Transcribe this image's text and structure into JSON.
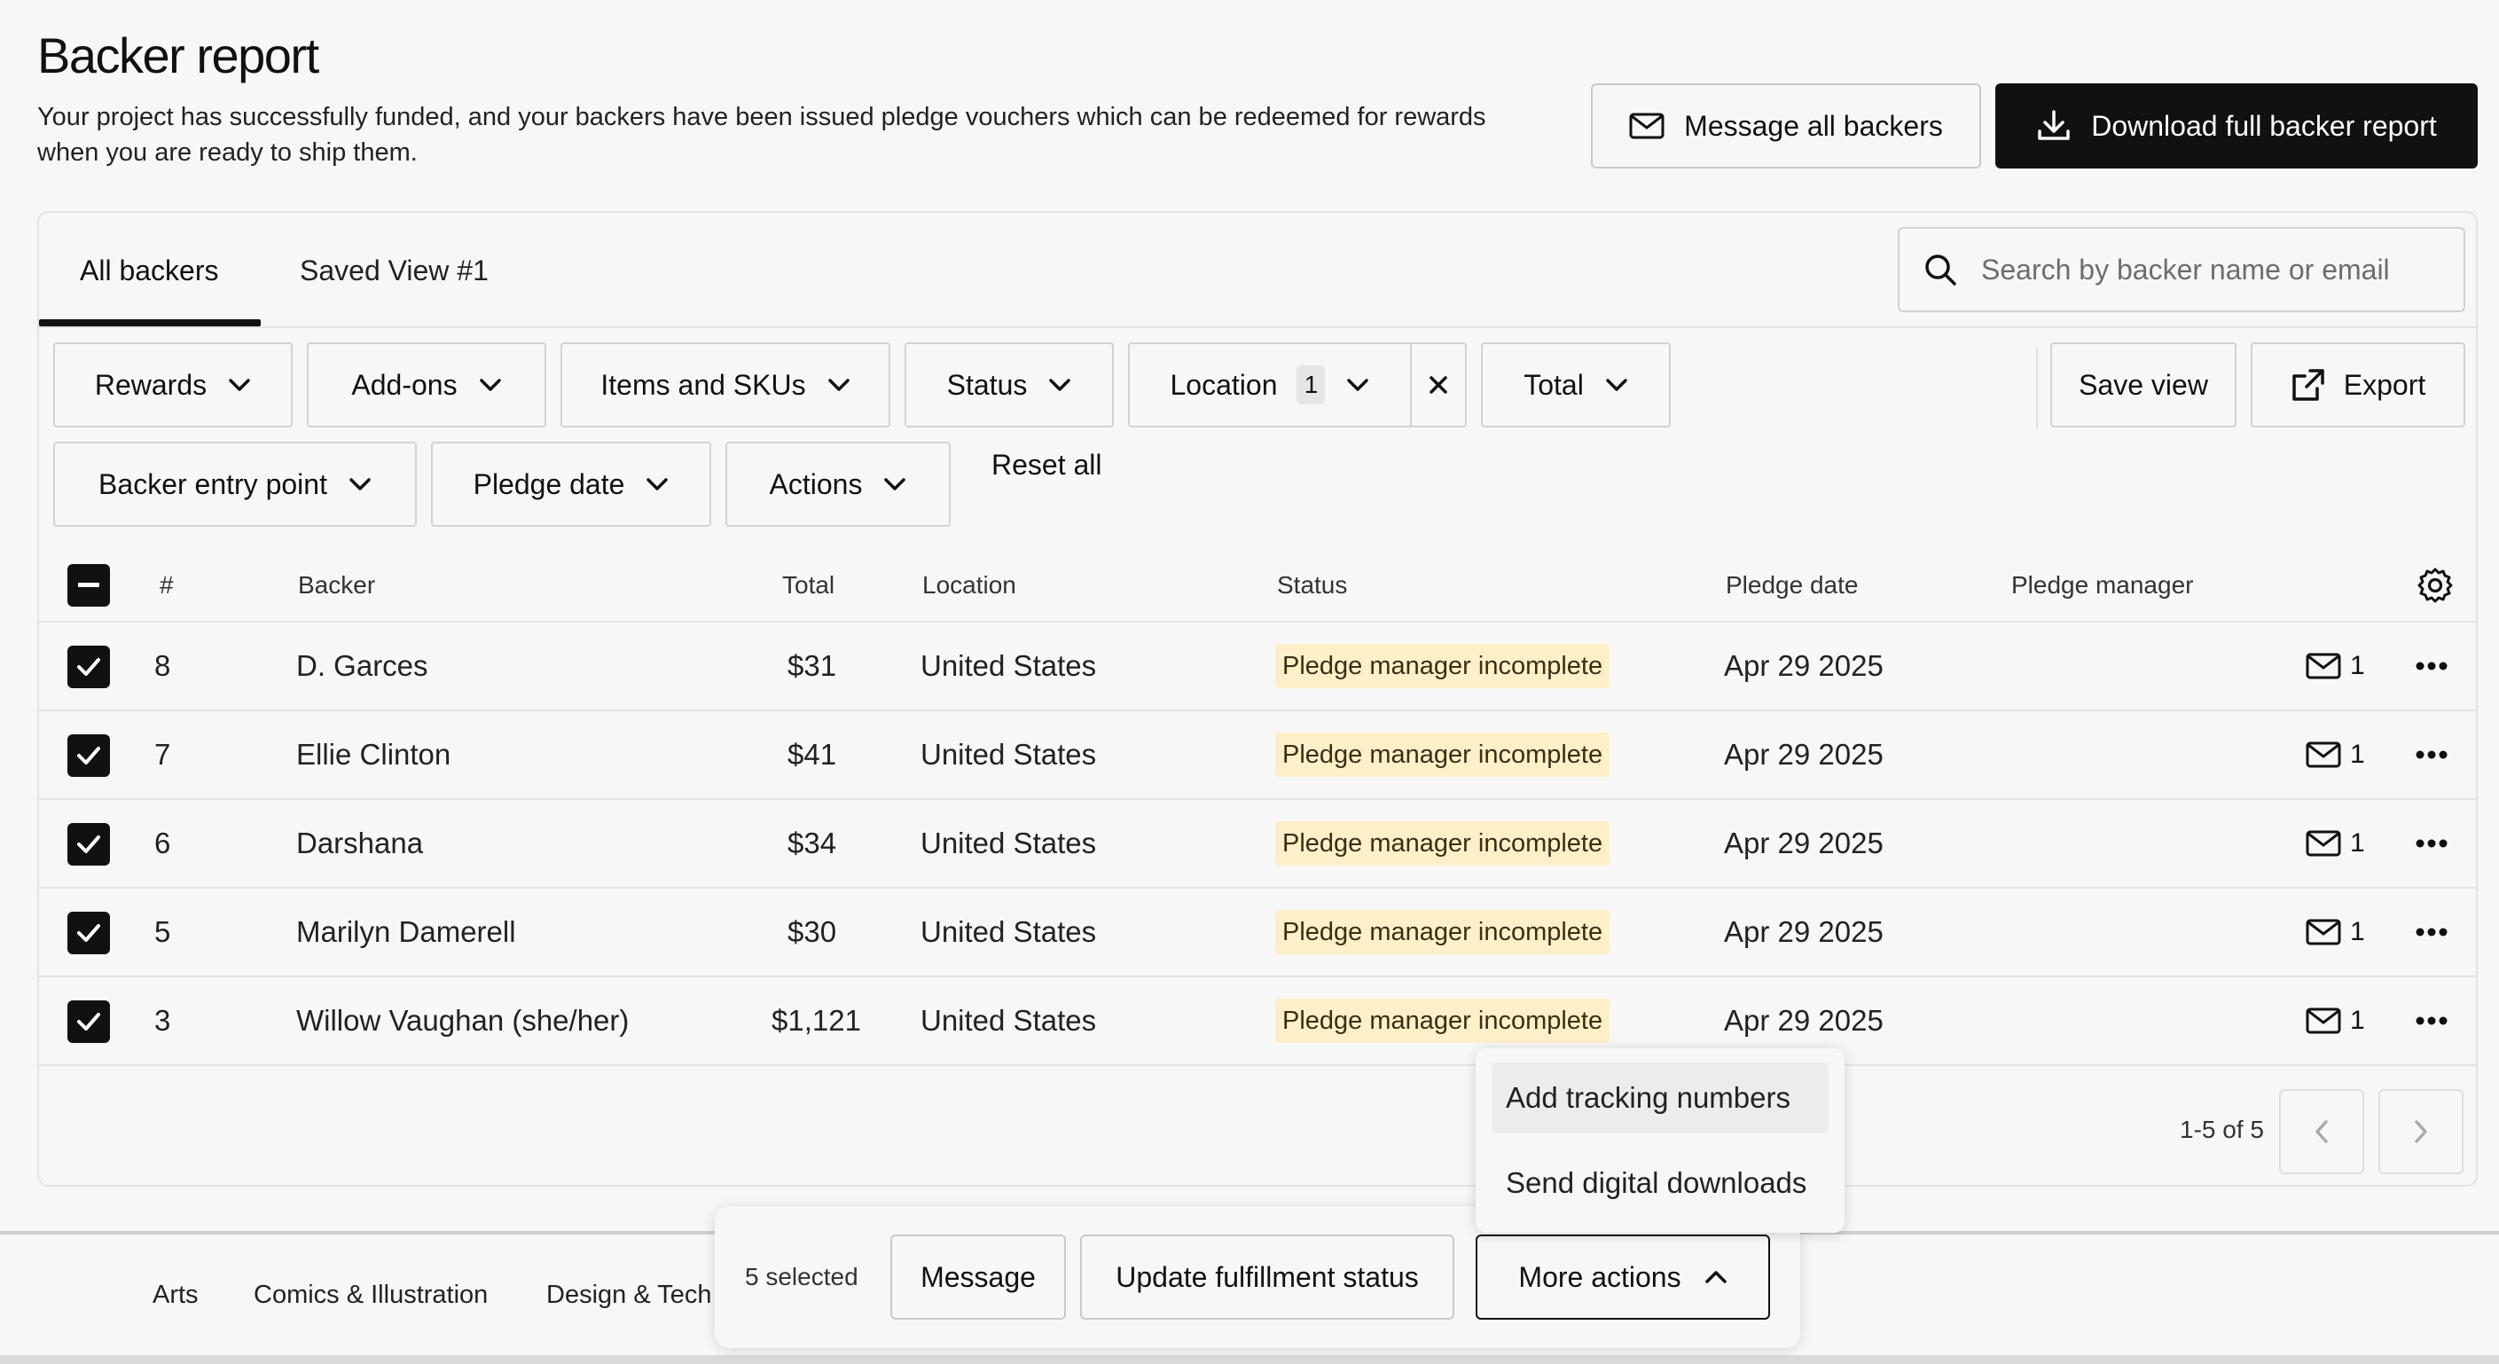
{
  "header": {
    "title": "Backer report",
    "description": "Your project has successfully funded, and your backers have been issued pledge vouchers which can be redeemed for rewards when you are ready to ship them.",
    "message_all_label": "Message all backers",
    "download_label": "Download full backer report"
  },
  "tabs": [
    {
      "label": "All backers",
      "active": true
    },
    {
      "label": "Saved View #1",
      "active": false
    }
  ],
  "search": {
    "placeholder": "Search by backer name or email"
  },
  "filters": {
    "rewards": "Rewards",
    "addons": "Add-ons",
    "items_skus": "Items and SKUs",
    "status": "Status",
    "location": "Location",
    "location_count": "1",
    "total": "Total",
    "backer_entry_point": "Backer entry point",
    "pledge_date": "Pledge date",
    "actions": "Actions",
    "reset_all": "Reset all",
    "save_view": "Save view",
    "export": "Export"
  },
  "table": {
    "columns": {
      "number": "#",
      "backer": "Backer",
      "total": "Total",
      "location": "Location",
      "status": "Status",
      "pledge_date": "Pledge date",
      "pledge_manager": "Pledge manager"
    },
    "rows": [
      {
        "num": "8",
        "backer": "D. Garces",
        "total": "$31",
        "location": "United States",
        "status": "Pledge manager incomplete",
        "date": "Apr 29 2025",
        "messages": "1",
        "checked": true
      },
      {
        "num": "7",
        "backer": "Ellie Clinton",
        "total": "$41",
        "location": "United States",
        "status": "Pledge manager incomplete",
        "date": "Apr 29 2025",
        "messages": "1",
        "checked": true
      },
      {
        "num": "6",
        "backer": "Darshana",
        "total": "$34",
        "location": "United States",
        "status": "Pledge manager incomplete",
        "date": "Apr 29 2025",
        "messages": "1",
        "checked": true
      },
      {
        "num": "5",
        "backer": "Marilyn Damerell",
        "total": "$30",
        "location": "United States",
        "status": "Pledge manager incomplete",
        "date": "Apr 29 2025",
        "messages": "1",
        "checked": true
      },
      {
        "num": "3",
        "backer": "Willow Vaughan (she/her)",
        "total": "$1,121",
        "location": "United States",
        "status": "Pledge manager incomplete",
        "date": "Apr 29 2025",
        "messages": "1",
        "checked": true
      }
    ]
  },
  "pagination": {
    "text": "1-5 of 5"
  },
  "footer": {
    "links": [
      "Arts",
      "Comics & Illustration",
      "Design & Tech"
    ]
  },
  "bulk_bar": {
    "selected_text": "5 selected",
    "message_label": "Message",
    "update_label": "Update fulfillment status",
    "more_actions_label": "More actions"
  },
  "more_actions_menu": {
    "items": [
      "Add tracking numbers",
      "Send digital downloads"
    ]
  },
  "colors": {
    "primary_dark": "#111111",
    "status_badge_bg": "#fdf0c8",
    "border": "#d2d2d2",
    "background": "#f7f7f7"
  }
}
